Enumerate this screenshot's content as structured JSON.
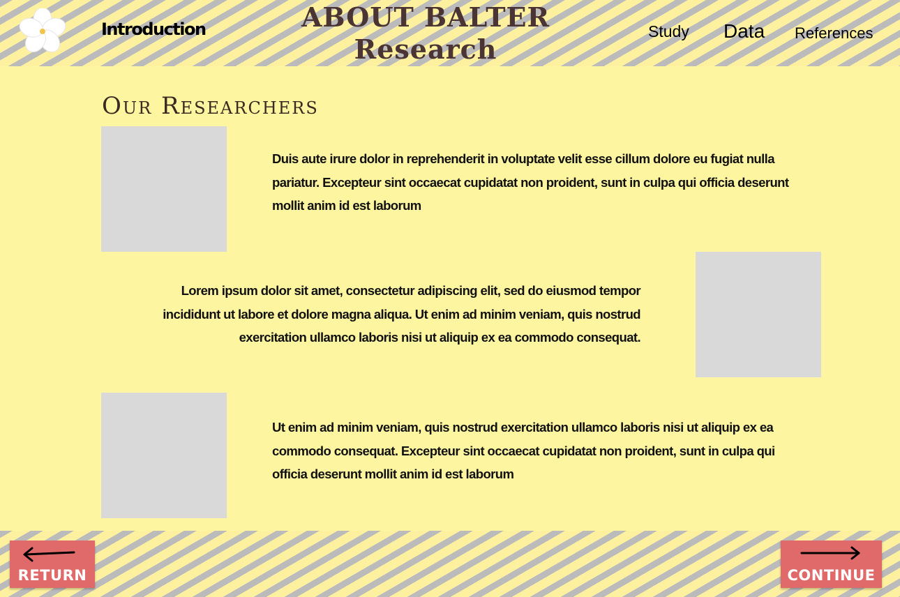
{
  "header": {
    "logo_icon": "white-flower-icon",
    "nav_introduction": "Introduction",
    "title_line1": "ABOUT BALTER",
    "title_line2": "Research",
    "nav_study": "Study",
    "nav_data": "Data",
    "nav_references": "References"
  },
  "main": {
    "section_title": "Our Researchers",
    "researchers": [
      {
        "bio": "Duis aute irure dolor in reprehenderit in voluptate velit esse cillum dolore eu fugiat nulla pariatur. Excepteur sint occaecat cupidatat non proident, sunt in culpa qui officia deserunt mollit anim id est laborum"
      },
      {
        "bio": "Lorem ipsum dolor sit amet, consectetur adipiscing elit, sed do eiusmod tempor incididunt ut labore et dolore magna aliqua. Ut enim ad minim veniam, quis nostrud exercitation ullamco laboris nisi ut aliquip ex ea commodo consequat."
      },
      {
        "bio": "Ut enim ad minim veniam, quis nostrud exercitation ullamco laboris nisi ut aliquip ex ea commodo consequat. Excepteur sint occaecat cupidatat non proident, sunt in culpa qui officia deserunt mollit anim id est laborum"
      }
    ]
  },
  "footer": {
    "return_label": "RETURN",
    "continue_label": "CONTINUE",
    "return_icon": "arrow-left-icon",
    "continue_icon": "arrow-right-icon"
  },
  "colors": {
    "background": "#fdf5a0",
    "stripe_yellow": "#fdf09f",
    "stripe_gray": "#b8b8be",
    "title_brown": "#4b3434",
    "button_red": "#e06a6a",
    "photo_placeholder": "#d9d9d9"
  }
}
